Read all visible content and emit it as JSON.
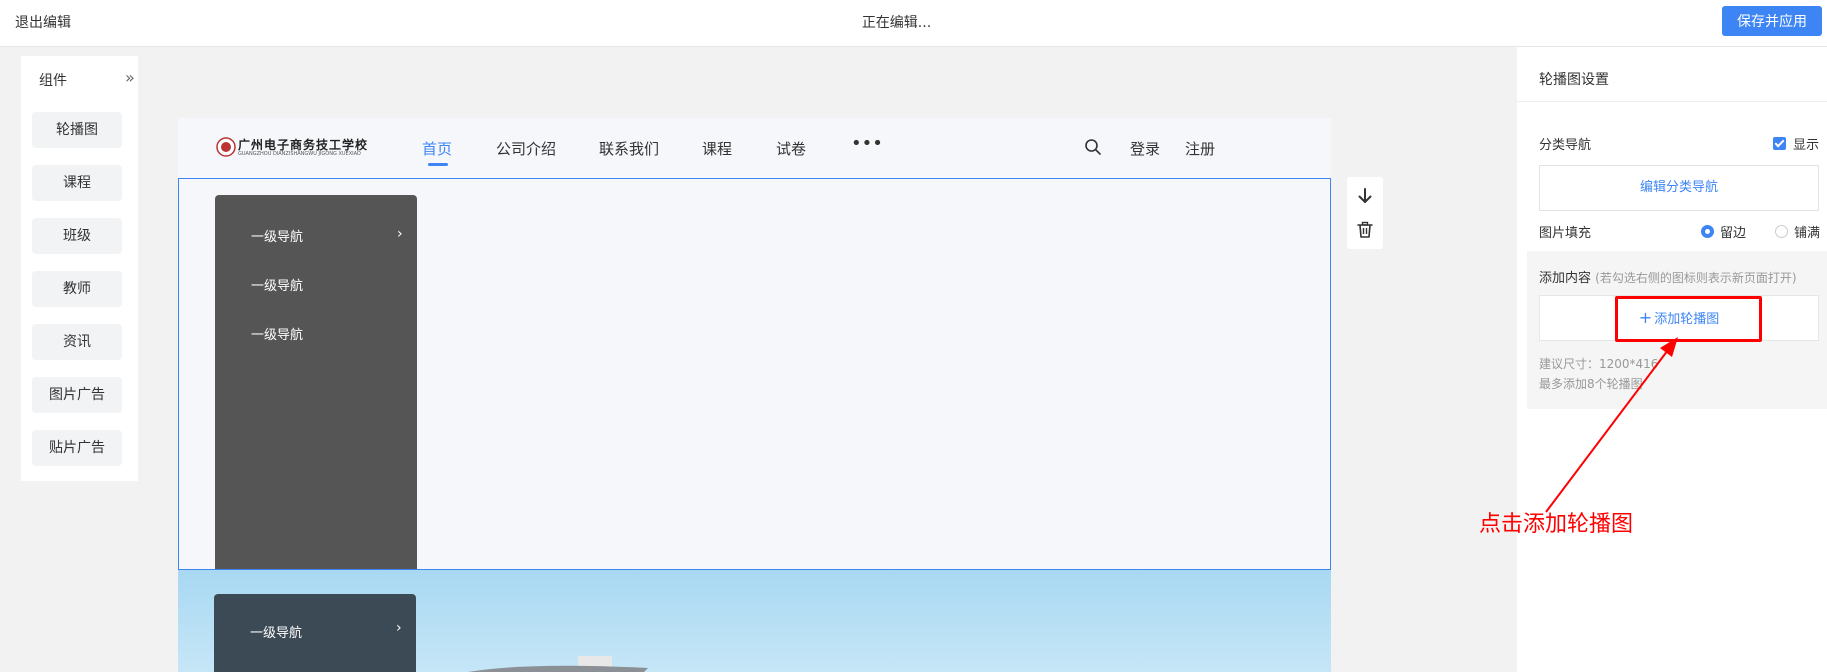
{
  "topbar": {
    "exit_label": "退出编辑",
    "status": "正在编辑...",
    "save_label": "保存并应用"
  },
  "components": {
    "title": "组件",
    "collapse_icon": "double-chevron-right-icon",
    "items": [
      {
        "label": "轮播图"
      },
      {
        "label": "课程"
      },
      {
        "label": "班级"
      },
      {
        "label": "教师"
      },
      {
        "label": "资讯"
      },
      {
        "label": "图片广告"
      },
      {
        "label": "贴片广告"
      }
    ]
  },
  "site": {
    "logo_text": "广州电子商务技工学校",
    "logo_subtext": "GUANGZHOU DIANZISHANGWU JIGONG XUEXIAO",
    "nav": [
      {
        "label": "首页",
        "active": true
      },
      {
        "label": "公司介绍"
      },
      {
        "label": "联系我们"
      },
      {
        "label": "课程"
      },
      {
        "label": "试卷"
      }
    ],
    "more_icon": "ellipsis-icon",
    "search_icon": "search-icon",
    "login_label": "登录",
    "register_label": "注册"
  },
  "carousel": {
    "categories": [
      {
        "label": "一级导航",
        "has_children": true
      },
      {
        "label": "一级导航"
      },
      {
        "label": "一级导航"
      }
    ],
    "banner_category": "一级导航"
  },
  "side_tools": {
    "move_down_icon": "arrow-down-icon",
    "delete_icon": "trash-icon"
  },
  "settings": {
    "title": "轮播图设置",
    "category_nav_label": "分类导航",
    "show_label": "显示",
    "show_checked": true,
    "edit_category_label": "编辑分类导航",
    "fill_label": "图片填充",
    "fill_options": [
      {
        "label": "留边",
        "checked": true
      },
      {
        "label": "铺满",
        "checked": false
      }
    ],
    "add_content_label": "添加内容",
    "add_content_hint": "(若勾选右侧的图标则表示新页面打开)",
    "add_carousel_label": "添加轮播图",
    "size_hint": "建议尺寸：1200*416",
    "limit_hint": "最多添加8个轮播图"
  },
  "annotation": {
    "text": "点击添加轮播图",
    "color": "#ff0000"
  },
  "colors": {
    "accent": "#3d85f4",
    "nav_panel": "#555555"
  }
}
